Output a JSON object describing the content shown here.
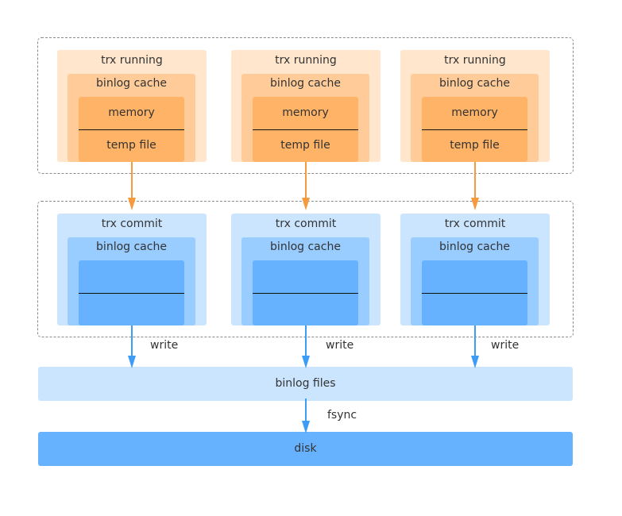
{
  "colors": {
    "orange_outer": "#ffe6cc",
    "orange_mid": "#ffcc99",
    "orange_inner": "#ffb366",
    "orange_arrow": "#f59a3d",
    "blue_outer": "#cce5ff",
    "blue_mid": "#99ccff",
    "blue_inner": "#66b2ff",
    "blue_arrow": "#3d9cf5"
  },
  "running_stage": {
    "columns": [
      {
        "title": "trx running",
        "cache_label": "binlog cache",
        "top_label": "memory",
        "bottom_label": "temp file"
      },
      {
        "title": "trx running",
        "cache_label": "binlog cache",
        "top_label": "memory",
        "bottom_label": "temp file"
      },
      {
        "title": "trx running",
        "cache_label": "binlog cache",
        "top_label": "memory",
        "bottom_label": "temp file"
      }
    ]
  },
  "commit_stage": {
    "columns": [
      {
        "title": "trx commit",
        "cache_label": "binlog cache"
      },
      {
        "title": "trx commit",
        "cache_label": "binlog cache"
      },
      {
        "title": "trx commit",
        "cache_label": "binlog cache"
      }
    ]
  },
  "edges": {
    "write_label": "write",
    "fsync_label": "fsync"
  },
  "binlog_files": {
    "label": "binlog files"
  },
  "disk": {
    "label": "disk"
  }
}
